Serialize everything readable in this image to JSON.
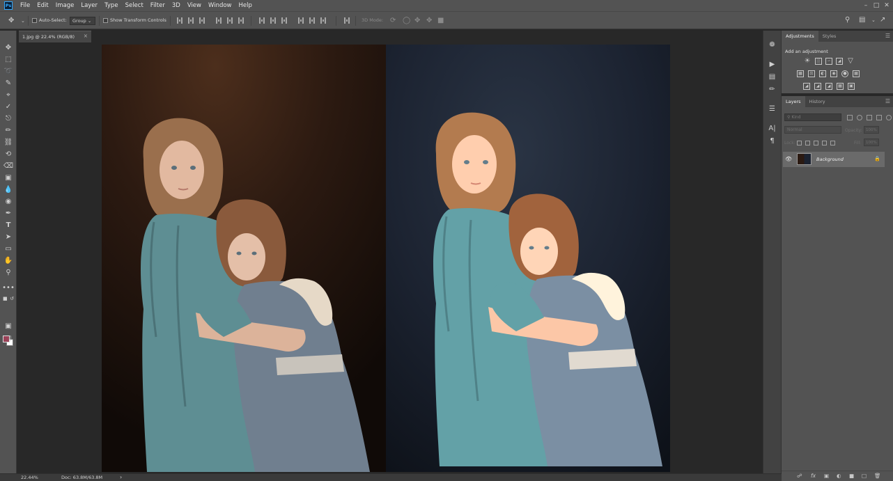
{
  "app": {
    "logo": "Ps",
    "menu": [
      "File",
      "Edit",
      "Image",
      "Layer",
      "Type",
      "Select",
      "Filter",
      "3D",
      "View",
      "Window",
      "Help"
    ],
    "window_controls": [
      "minimize-icon",
      "maximize-icon",
      "close-icon"
    ]
  },
  "options": {
    "auto_select_label": "Auto-Select:",
    "auto_select_value": "Group",
    "show_transform_label": "Show Transform Controls",
    "mode_3d_label": "3D Mode:"
  },
  "document": {
    "tab_title": "1.jpg @ 22.4% (RGB/8)",
    "tab_close": "×",
    "zoom": "22.44%",
    "doc_info": "Doc: 63.8M/63.8M",
    "foreground_color": "#9a4258",
    "background_color": "#ffffff"
  },
  "tools": [
    "move-tool-icon",
    "marquee-tool-icon",
    "lasso-tool-icon",
    "quick-select-tool-icon",
    "crop-tool-icon",
    "eyedropper-tool-icon",
    "healing-brush-tool-icon",
    "brush-tool-icon",
    "clone-stamp-tool-icon",
    "history-brush-tool-icon",
    "eraser-tool-icon",
    "gradient-tool-icon",
    "blur-tool-icon",
    "dodge-tool-icon",
    "pen-tool-icon",
    "type-tool-icon",
    "path-select-tool-icon",
    "rectangle-tool-icon",
    "hand-tool-icon",
    "zoom-tool-icon",
    "more-tools-icon"
  ],
  "adjustments": {
    "tabs": [
      "Adjustments",
      "Styles"
    ],
    "title": "Add an adjustment"
  },
  "layers": {
    "tabs": [
      "Layers",
      "History"
    ],
    "filter_placeholder": "Kind",
    "blend_mode": "Normal",
    "opacity_label": "Opacity:",
    "opacity_value": "100%",
    "lock_label": "Lock:",
    "fill_label": "Fill:",
    "fill_value": "100%",
    "items": [
      {
        "name": "Background",
        "visible": true,
        "locked": true
      }
    ]
  }
}
